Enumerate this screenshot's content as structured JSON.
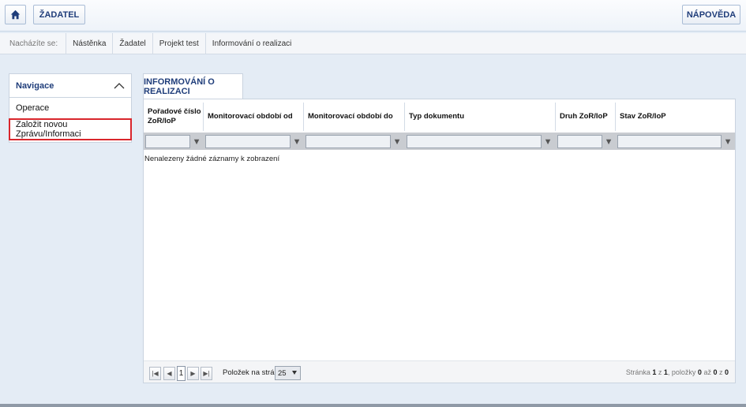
{
  "topbar": {
    "home_icon": "home-icon",
    "zadatel_label": "ŽADATEL",
    "napoveda_label": "NÁPOVĚDA"
  },
  "breadcrumb": {
    "label": "Nacházíte se:",
    "items": [
      "Nástěnka",
      "Žadatel",
      "Projekt test",
      "Informování o realizaci"
    ]
  },
  "navigation": {
    "title": "Navigace",
    "collapse_icon": "chevron-up-icon",
    "items": [
      "Operace",
      "Založit novou Zprávu/Informaci"
    ]
  },
  "main": {
    "tab_label": "INFORMOVÁNÍ O REALIZACI",
    "columns": [
      "Pořadové číslo ZoR/IoP",
      "Monitorovací období od",
      "Monitorovací období do",
      "Typ dokumentu",
      "Druh ZoR/IoP",
      "Stav ZoR/IoP"
    ],
    "empty_message": "Nenalezeny žádné záznamy k zobrazení"
  },
  "pager": {
    "current_page": "1",
    "per_page_label": "Položek na stránku",
    "per_page_value": "25",
    "info_prefix": "Stránka ",
    "info_page": "1",
    "info_mid": " z ",
    "info_total_pages": "1",
    "info_items_label": ", položky ",
    "info_from": "0",
    "info_to_label": " až ",
    "info_to": "0",
    "info_of_label": " z ",
    "info_total": "0"
  },
  "colors": {
    "brand_blue": "#1f3d7a",
    "highlight_red": "#d9262c",
    "background": "#e4ecf5"
  }
}
